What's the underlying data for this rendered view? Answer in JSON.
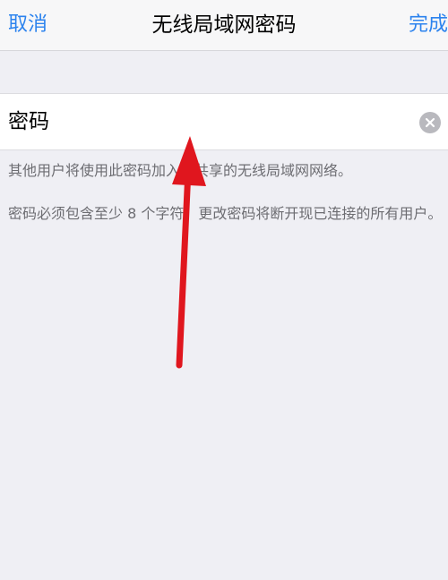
{
  "nav": {
    "cancel_label": "取消",
    "title": "无线局域网密码",
    "done_label": "完成"
  },
  "password_field": {
    "placeholder": "密码",
    "value": ""
  },
  "notes": [
    "其他用户将使用此密码加入您共享的无线局域网网络。",
    "密码必须包含至少 8 个字符。更改密码将断开现已连接的所有用户。"
  ],
  "colors": {
    "accent": "#2c83ee",
    "background": "#efeff4",
    "annotation_arrow": "#e0161e"
  },
  "icons": {
    "clear": "clear-icon",
    "annotation": "red-arrow-annotation"
  }
}
